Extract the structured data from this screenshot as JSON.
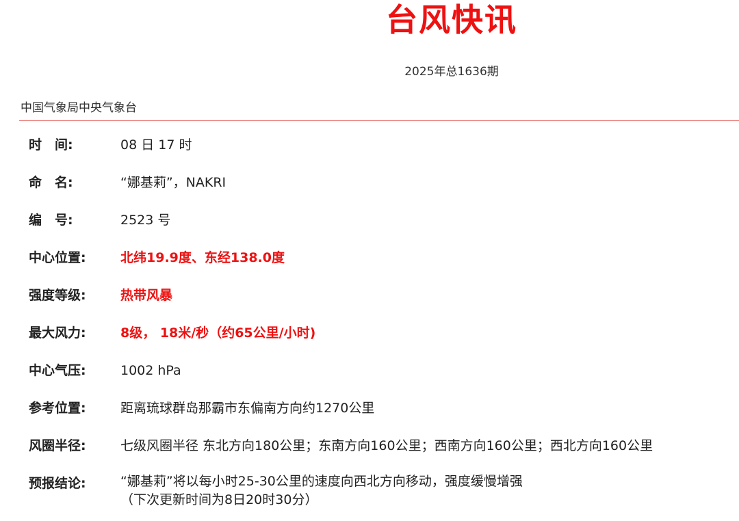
{
  "header": {
    "title": "台风快讯",
    "issue": "2025年总1636期",
    "agency": "中国气象局中央气象台"
  },
  "fields": [
    {
      "label": "时　间:",
      "value": "08 日 17 时"
    },
    {
      "label": "命　名:",
      "value": "“娜基莉”，NAKRI"
    },
    {
      "label": "编　号:",
      "value": "2523 号"
    },
    {
      "label": "中心位置:",
      "value": "北纬19.9度、东经138.0度"
    },
    {
      "label": "强度等级:",
      "value": "热带风暴"
    },
    {
      "label": "最大风力:",
      "value": "8级， 18米/秒（约65公里/小时)"
    },
    {
      "label": "中心气压:",
      "value": "1002 hPa"
    },
    {
      "label": "参考位置:",
      "value": "距离琉球群岛那霸市东偏南方向约1270公里"
    },
    {
      "label": "风圈半径:",
      "value": "七级风圈半径 东北方向180公里；东南方向160公里；西南方向160公里；西北方向160公里"
    },
    {
      "label": "预报结论:",
      "value_lines": [
        "“娜基莉”将以每小时25-30公里的速度向西北方向移动，强度缓慢增强",
        "（下次更新时间为8日20时30分）"
      ]
    }
  ],
  "colors": {
    "title": "#ee1111",
    "highlight": "#ee1111",
    "divider": "#e8776f",
    "text": "#222222"
  }
}
